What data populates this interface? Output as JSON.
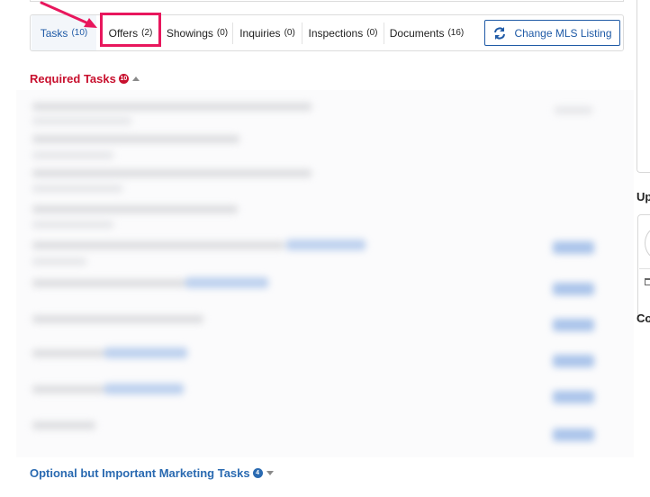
{
  "tabs": [
    {
      "label": "Tasks",
      "count": "(10)"
    },
    {
      "label": "Offers",
      "count": "(2)"
    },
    {
      "label": "Showings",
      "count": "(0)"
    },
    {
      "label": "Inquiries",
      "count": "(0)"
    },
    {
      "label": "Inspections",
      "count": "(0)"
    },
    {
      "label": "Documents",
      "count": "(16)"
    }
  ],
  "active_tab": "Tasks",
  "highlighted_tab": "Offers",
  "change_mls_button": {
    "label": "Change MLS Listing",
    "icon": "refresh-icon"
  },
  "sections": {
    "required": {
      "title": "Required Tasks",
      "badge": "10",
      "caret": "up"
    },
    "optional": {
      "title": "Optional but Important Marketing Tasks",
      "badge": "4",
      "caret": "down"
    }
  },
  "side": {
    "heading_1": "Up",
    "heading_2": "Co"
  },
  "colors": {
    "required_red": "#c8102e",
    "link_blue": "#1f5aa6",
    "highlight_pink": "#e8175d",
    "optional_blue": "#2a6ab1"
  }
}
